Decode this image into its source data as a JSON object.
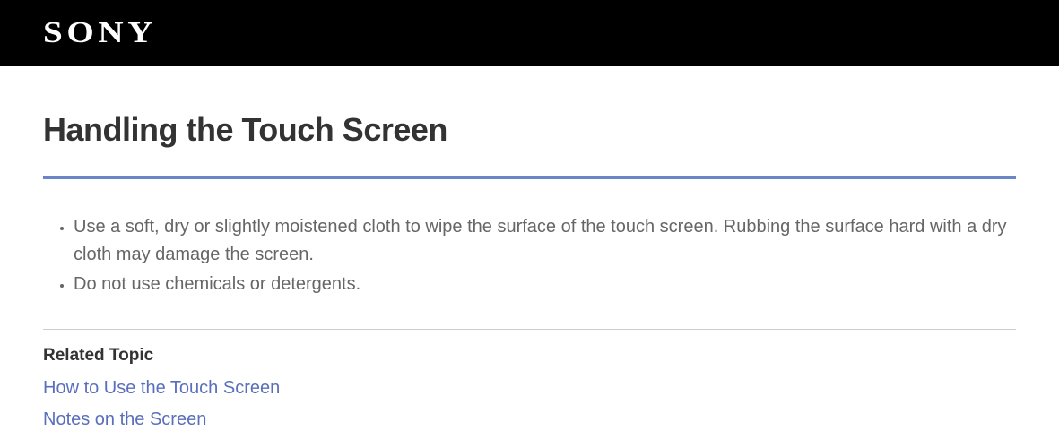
{
  "header": {
    "brand": "SONY"
  },
  "main": {
    "title": "Handling the Touch Screen",
    "bullets": [
      "Use a soft, dry or slightly moistened cloth to wipe the surface of the touch screen. Rubbing the surface hard with a dry cloth may damage the screen.",
      "Do not use chemicals or detergents."
    ],
    "related_heading": "Related Topic",
    "related_links": [
      "How to Use the Touch Screen",
      "Notes on the Screen"
    ]
  }
}
